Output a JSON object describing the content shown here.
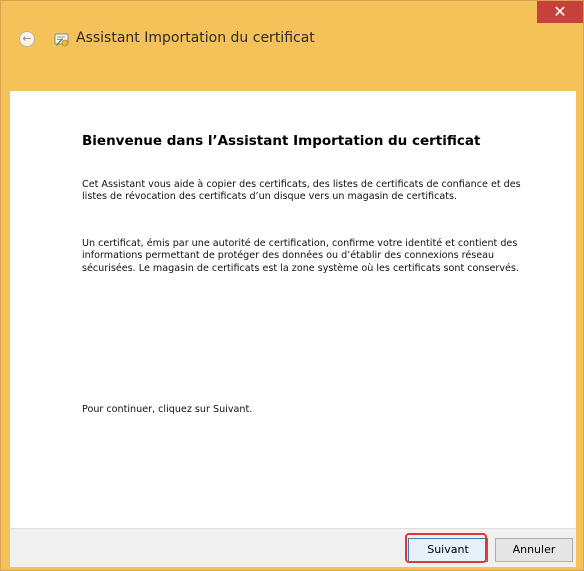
{
  "window": {
    "close_glyph": "✕",
    "back_glyph": "←",
    "title": "Assistant Importation du certificat"
  },
  "content": {
    "heading": "Bienvenue dans l’Assistant Importation du certificat",
    "paragraph1": "Cet Assistant vous aide à copier des certificats, des listes de certificats de confiance et des listes de révocation des certificats d’un disque vers un magasin de certificats.",
    "paragraph2": "Un certificat, émis par une autorité de certification, confirme votre identité et contient des informations permettant de protéger des données ou d’établir des connexions réseau sécurisées. Le magasin de certificats est la zone système où les certificats sont conservés.",
    "paragraph3": "Pour continuer, cliquez sur Suivant."
  },
  "footer": {
    "next_label": "Suivant",
    "cancel_label": "Annuler"
  },
  "colors": {
    "frame": "#f5c25a",
    "close": "#c7413c",
    "highlight": "#e0343b"
  }
}
